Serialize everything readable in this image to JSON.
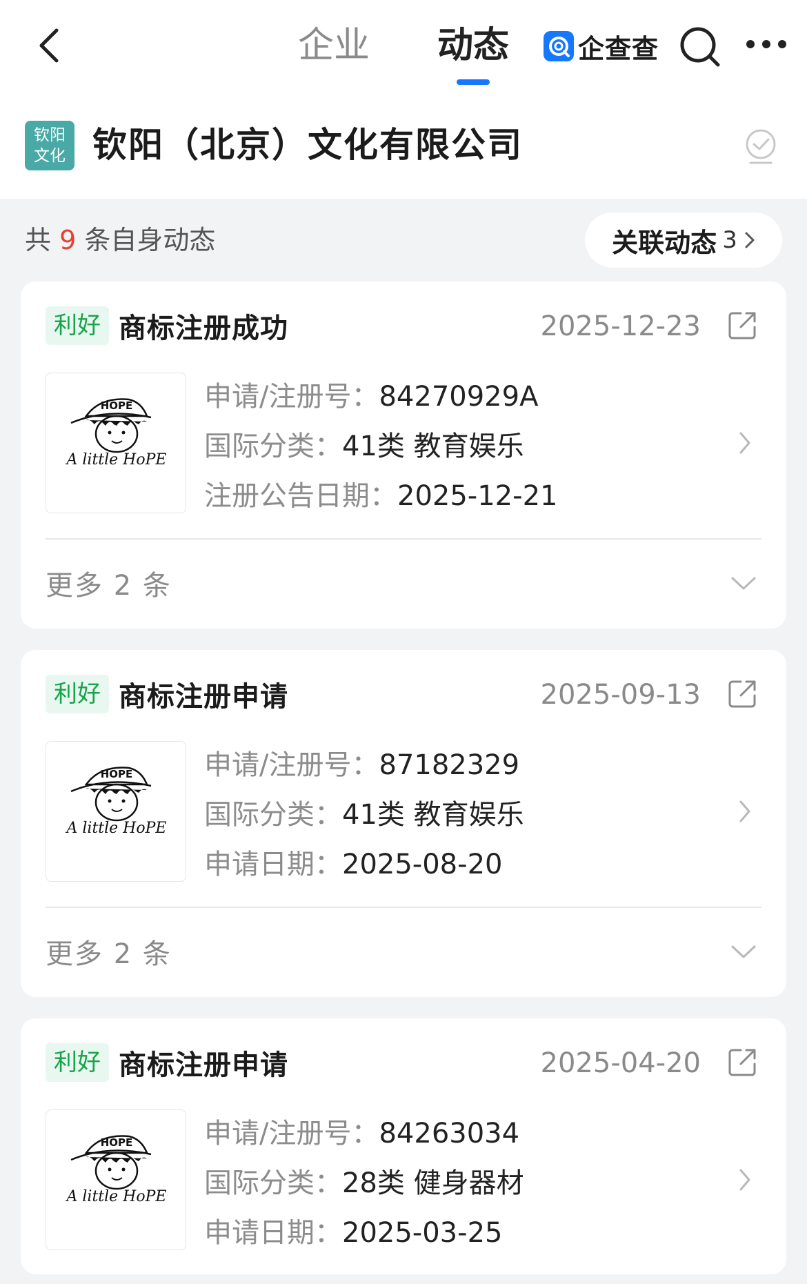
{
  "header": {
    "tabs": [
      {
        "label": "企业",
        "active": false
      },
      {
        "label": "动态",
        "active": true
      }
    ],
    "brand": "企查查",
    "accent_color": "#1677ff"
  },
  "company": {
    "logo_lines": [
      "钦阳",
      "文化"
    ],
    "name": "钦阳（北京）文化有限公司",
    "logo_color": "#48a9a6"
  },
  "summary": {
    "prefix": "共",
    "count": "9",
    "suffix": "条自身动态",
    "related_label": "关联动态",
    "related_count": "3"
  },
  "cards": [
    {
      "badge": "利好",
      "title": "商标注册成功",
      "date": "2025-12-23",
      "thumb_top": "HOPE",
      "thumb_caption": "A little HoPE",
      "rows": [
        {
          "label": "申请/注册号：",
          "value": "84270929A"
        },
        {
          "label": "国际分类：",
          "value": "41类 教育娱乐"
        },
        {
          "label": "注册公告日期：",
          "value": "2025-12-21"
        }
      ],
      "more": "更多 2 条"
    },
    {
      "badge": "利好",
      "title": "商标注册申请",
      "date": "2025-09-13",
      "thumb_top": "HOPE",
      "thumb_caption": "A little HoPE",
      "rows": [
        {
          "label": "申请/注册号：",
          "value": "87182329"
        },
        {
          "label": "国际分类：",
          "value": "41类 教育娱乐"
        },
        {
          "label": "申请日期：",
          "value": "2025-08-20"
        }
      ],
      "more": "更多 2 条"
    },
    {
      "badge": "利好",
      "title": "商标注册申请",
      "date": "2025-04-20",
      "thumb_top": "HOPE",
      "thumb_caption": "A little HoPE",
      "rows": [
        {
          "label": "申请/注册号：",
          "value": "84263034"
        },
        {
          "label": "国际分类：",
          "value": "28类 健身器材"
        },
        {
          "label": "申请日期：",
          "value": "2025-03-25"
        }
      ]
    }
  ]
}
